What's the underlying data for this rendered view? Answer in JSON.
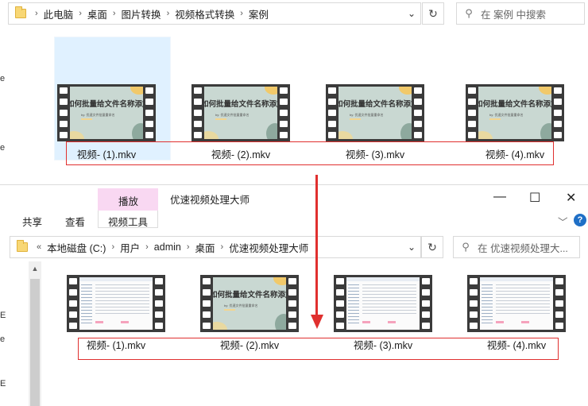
{
  "top_window": {
    "breadcrumb": [
      "此电脑",
      "桌面",
      "图片转换",
      "视频格式转换",
      "案例"
    ],
    "search_placeholder": "在 案例 中搜索",
    "refresh_icon": "refresh-icon",
    "files": [
      {
        "name": "视频- (1).mkv",
        "thumb_title": "如何批量给文件名称添加序号",
        "thumb_sub": "by: 优速文件批量重命名"
      },
      {
        "name": "视频- (2).mkv",
        "thumb_title": "如何批量给文件名称添加序号",
        "thumb_sub": "by: 优速文件批量重命名"
      },
      {
        "name": "视频- (3).mkv",
        "thumb_title": "如何批量给文件名称添加序号",
        "thumb_sub": "by: 优速文件批量重命名"
      },
      {
        "name": "视频- (4).mkv",
        "thumb_title": "如何批量给文件名称添加序号",
        "thumb_sub": "by: 优速文件批量重命名"
      }
    ]
  },
  "bottom_window": {
    "title": "优速视频处理大师",
    "ribbon": {
      "context_group": "播放",
      "tabs": [
        "共享",
        "查看",
        "视频工具"
      ]
    },
    "window_controls": {
      "minimize": "—",
      "maximize": "☐",
      "close": "✕"
    },
    "help_icon": "?",
    "expand_icon": "﹀",
    "breadcrumb_prefix": "«",
    "breadcrumb": [
      "本地磁盘 (C:)",
      "用户",
      "admin",
      "桌面",
      "优速视频处理大师"
    ],
    "search_placeholder": "在 优速视频处理大...",
    "files": [
      {
        "name": "视频- (1).mkv",
        "thumb": "screenshot"
      },
      {
        "name": "视频- (2).mkv",
        "thumb": "slide",
        "thumb_title": "如何批量给文件名称添加序号",
        "thumb_sub": "by: 优速文件批量重命名"
      },
      {
        "name": "视频- (3).mkv",
        "thumb": "screenshot"
      },
      {
        "name": "视频- (4).mkv",
        "thumb": "screenshot"
      }
    ]
  },
  "left_edge_letters": [
    "e",
    "e",
    "E",
    "e",
    "E",
    "E"
  ],
  "colors": {
    "annotation_red": "#e0302f",
    "context_tab_pink": "#f9d8f2",
    "selection_blue": "#cce8ff"
  }
}
